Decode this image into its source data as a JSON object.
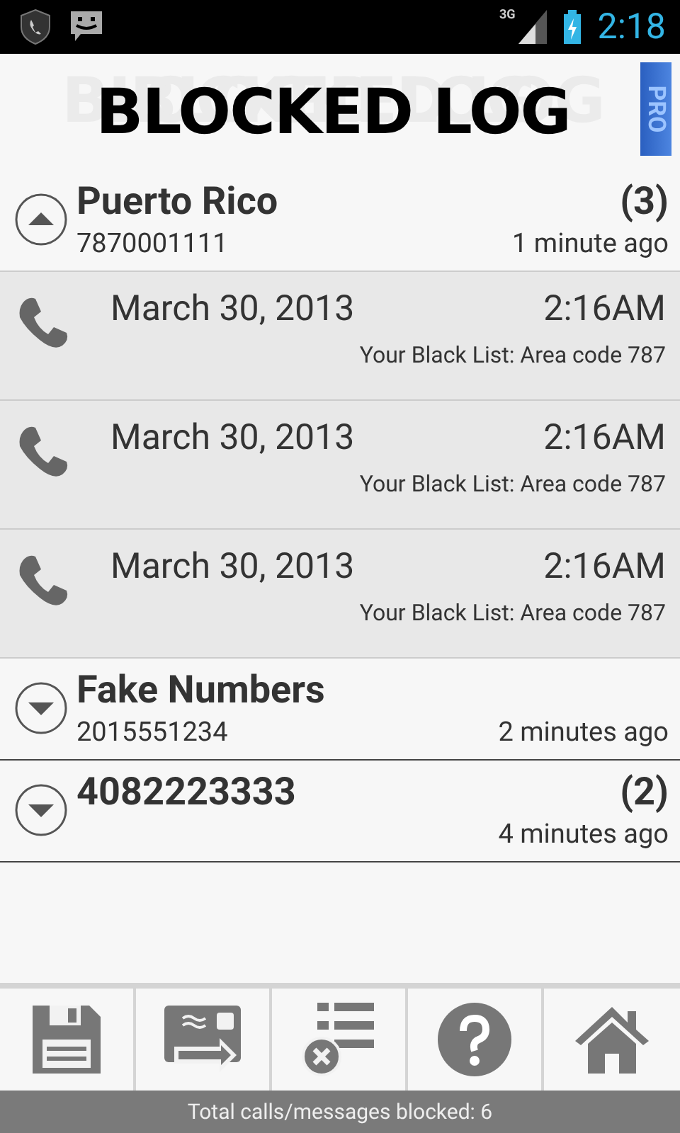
{
  "status_bar": {
    "time": "2:18",
    "network": "3G"
  },
  "header": {
    "title": "BLOCKED LOG",
    "badge": "PRO"
  },
  "groups": [
    {
      "name": "Puerto Rico",
      "number": "7870001111",
      "count": "(3)",
      "time": "1 minute ago",
      "expanded": true,
      "entries": [
        {
          "date": "March 30, 2013",
          "time": "2:16AM",
          "reason": "Your Black List: Area code 787"
        },
        {
          "date": "March 30, 2013",
          "time": "2:16AM",
          "reason": "Your Black List: Area code 787"
        },
        {
          "date": "March 30, 2013",
          "time": "2:16AM",
          "reason": "Your Black List: Area code 787"
        }
      ]
    },
    {
      "name": "Fake Numbers",
      "number": "2015551234",
      "time": "2 minutes ago",
      "expanded": false
    },
    {
      "name": "4082223333",
      "count": "(2)",
      "time": "4 minutes ago",
      "expanded": false
    }
  ],
  "toolbar": [
    {
      "kind": "save"
    },
    {
      "kind": "forward"
    },
    {
      "kind": "clear"
    },
    {
      "kind": "help"
    },
    {
      "kind": "home"
    }
  ],
  "footer": "Total calls/messages blocked: 6"
}
